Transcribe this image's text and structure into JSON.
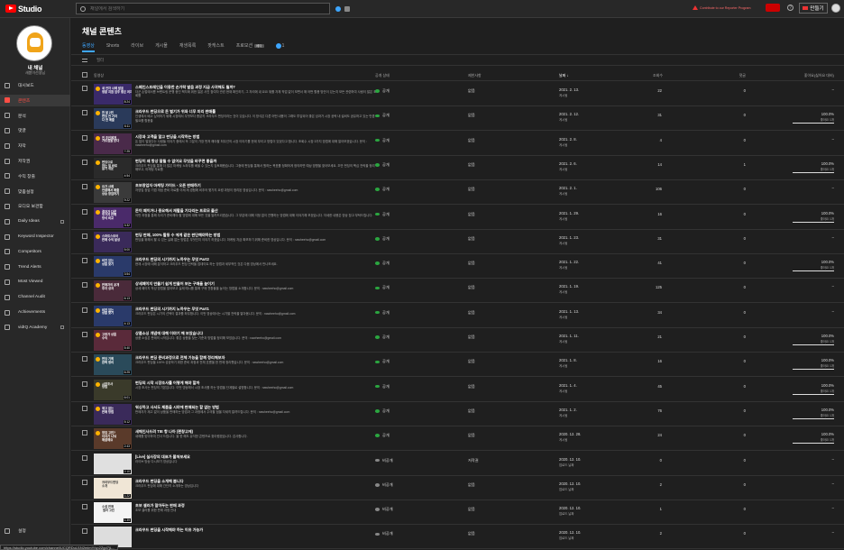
{
  "header": {
    "brand": "Studio",
    "search_placeholder": "채널에서 검색하기",
    "warning": "Contribute to our Reporter Program",
    "create": "만들기",
    "help": "?"
  },
  "sidebar": {
    "channel_name": "내 채널",
    "channel_sub": "새봄이선생님",
    "items": [
      {
        "label": "대시보드",
        "icon": "dashboard-icon"
      },
      {
        "label": "콘텐츠",
        "icon": "content-icon",
        "active": true
      },
      {
        "label": "분석",
        "icon": "analytics-icon"
      },
      {
        "label": "댓글",
        "icon": "comments-icon"
      },
      {
        "label": "자막",
        "icon": "subtitles-icon"
      },
      {
        "label": "저작권",
        "icon": "copyright-icon"
      },
      {
        "label": "수익 창출",
        "icon": "monetization-icon"
      },
      {
        "label": "맞춤설정",
        "icon": "customization-icon"
      },
      {
        "label": "오디오 보관함",
        "icon": "audio-library-icon"
      },
      {
        "label": "Daily Ideas",
        "icon": "ideas-icon",
        "ext": true
      },
      {
        "label": "Keyword Inspector",
        "icon": "keyword-icon"
      },
      {
        "label": "Competitors",
        "icon": "competitors-icon"
      },
      {
        "label": "Trend Alerts",
        "icon": "trend-icon"
      },
      {
        "label": "Most Viewed",
        "icon": "most-viewed-icon"
      },
      {
        "label": "Channel Audit",
        "icon": "audit-icon"
      },
      {
        "label": "Achievements",
        "icon": "achievements-icon"
      },
      {
        "label": "vidIQ Academy",
        "icon": "academy-icon",
        "ext": true
      }
    ],
    "settings": "설정"
  },
  "main": {
    "title": "채널 콘텐츠",
    "tabs": [
      "동영상",
      "Shorts",
      "라이브",
      "게시물",
      "재생목록",
      "팟캐스트",
      "프로모션"
    ],
    "beta": "베타",
    "globe_count": "1",
    "filter": "필터",
    "columns": {
      "video": "동영상",
      "visibility": "공개 상태",
      "restrictions": "제한사항",
      "date": "날짜 ↓",
      "views": "조회수",
      "comments": "댓글",
      "likes": "좋아요(싫어요 대비)"
    }
  },
  "videos": [
    {
      "title": "스페인스프레인을 이용한 손가락 발음 과정 지금 사귀해도 될까?",
      "desc": "더군 손법에서름 브랜트링 운행 중인 책자에 위한 일본 사진 참여자 관련 현재 확인하기, 그 자리에 내 요요 위를 자체 작업 없이 보면서 해 어떤 활용 방안이 있는지 모든 관련하여 사람이 많은 조회를",
      "thumb": "새 연차 사례 발표\n정말 지원 엄주 좋은 여자",
      "thumb_color": "#3a2a6a",
      "dur": "8:24",
      "vis": "공개",
      "restr": "없음",
      "date": "2021. 2. 13.",
      "dtype": "게시됨",
      "views": "22",
      "comments": "0",
      "likes": "–",
      "likes_sub": ""
    },
    {
      "title": "크라우드 펀딩으로 돈 벌기가 위와 너무 미리 판매를",
      "desc": "인생에서 배고 싶어하기 위해 시장에서 무엇보다 충분히 크라우드 펀딩이라는 것이 있습니다. 이 방식은 다른 어떤 내용이 그래도 투입되어 좋은 성과가 시장 공략 내 설비도 공유하고 있는 만큼 필요를 활용을",
      "thumb": "한 달 2번 \n펀딩 천 가지\n다 한 매출",
      "thumb_color": "#2a3a5a",
      "dur": "6:11",
      "vis": "공개",
      "restr": "없음",
      "date": "2021. 2. 12.",
      "dtype": "게시됨",
      "views": "31",
      "comments": "0",
      "likes": "100.0%",
      "likes_sub": "좋아요 1개"
    },
    {
      "title": "시장과 고객을 알고 펀딩을 시작하는 방법",
      "desc": "돈 많이 벌었다는 사람들 이야기 중에서 꼭 그분이 가장 먼저 해야할 최우선의 시장 이야기를 한데 부리고 방법이 있었다고 합니다. 조회수 시장 3가지 방법에 대해 알아보겠습니다. 문의 : nawheeho@gmail.com",
      "thumb": "전 주인에게\n가르침을 받다",
      "thumb_color": "#4a2a4a",
      "dur": "7:25",
      "vis": "공개",
      "restr": "없음",
      "date": "2021. 2. 8.",
      "dtype": "게시됨",
      "views": "4",
      "comments": "0",
      "likes": "–",
      "likes_sub": ""
    },
    {
      "title": "펀딩이 왜 항상 잘될 수 없어요 무엇을 바꾸면 좋을까",
      "desc": "크라우드 펀딩을 통해 더 많은 마케팅 노하우를 배울 수 있는지 검토해봤습니다. 그중에 펀딩을 통해서 원하는 목표를 정확하게 정의하면 예상 방향을 찾아보세요. 초반 펀딩의 핵심 전략을 정리해보고, 마케팅 자료를",
      "thumb": "펀딩으로\n하는 일 바로\n알기 쉬운",
      "thumb_color": "#2a2a2a",
      "dur": "4:54",
      "vis": "공개",
      "restr": "없음",
      "date": "2021. 2. 6.",
      "dtype": "게시됨",
      "views": "14",
      "comments": "1",
      "likes": "100.0%",
      "likes_sub": "좋아요 1개"
    },
    {
      "title": "초보창업자 마케팅 가이드 - 오픈 판매하기",
      "desc": "자영업 창업 기법 개념 준비 자료를 이제 제 경험에 비추어 몇가지 요령 과정이 정리된 영상입니다. 문의 : nawheeho@gmail.com",
      "thumb": "요가 사례\n연결해서 매출\n상승 창업하기",
      "thumb_color": "#3a3a3a",
      "dur": "9:22",
      "vis": "공개",
      "restr": "없음",
      "date": "2021. 2. 1.",
      "dtype": "게시됨",
      "views": "106",
      "comments": "0",
      "likes": "–",
      "likes_sub": ""
    },
    {
      "title": "돈이 떼이거나 중요해서 재활을 기다리는 프로모 출산",
      "desc": "이번 과정을 통해 우리가 준비해야 할 방법에 대해 모든 것을 알려드리겠습니다. 그 부분에 대해 걱정 없이 진행하는 방법에 대해 이야기해 보겠습니다. 자세한 내용은 영상 참고 부탁드립니다.",
      "thumb": "결과가 다른\n두가지 판매\n방식 비교",
      "thumb_color": "#4a2a6a",
      "dur": "3:32",
      "vis": "공개",
      "restr": "없음",
      "date": "2021. 1. 29.",
      "dtype": "게시됨",
      "views": "16",
      "comments": "0",
      "likes": "100.0%",
      "likes_sub": "좋아요 1개"
    },
    {
      "title": "펀딩 판매, 100% 활동 수 에게 같은 판단해야하는 방법",
      "desc": "펀딩을 위해서 할 수 있는 실패 없는 방법은 무엇인지 이야기 하겠습니다. 마케팅 자금 확보하기 위해 준비한 영상입니다. 문의 : nawheeho@gmail.com",
      "thumb": "스마트스토어\n판매 수익 달성",
      "thumb_color": "#3a2a5a",
      "dur": "5:00",
      "vis": "공개",
      "restr": "없음",
      "date": "2021. 1. 23.",
      "dtype": "게시됨",
      "views": "31",
      "comments": "0",
      "likes": "–",
      "likes_sub": ""
    },
    {
      "title": "크라우드 펀딩의 시기까지 노하우는 무엇 Part2",
      "desc": "현재 시장에 대해 분석하고 크라우드 펀딩 전략을 업데이트 하는 방법과 세부적인 것은 다음 영상에서 만나보세요.",
      "thumb": "비전 있는\n상품 찾기",
      "thumb_color": "#2a3a6a",
      "dur": "3:54",
      "vis": "공개",
      "restr": "없음",
      "date": "2021. 1. 22.",
      "dtype": "게시됨",
      "views": "41",
      "comments": "0",
      "likes": "100.0%",
      "likes_sub": "좋아요 1개"
    },
    {
      "title": "상세페이지 만들기 쉽게 만들어 보는 구매율 높이기",
      "desc": "상세 페이지 작성 방법을 알아보고 실제 예시를 통해 구매 전환율을 높이는 방법을 소개합니다. 문의 : nawheeho@gmail.com",
      "thumb": "판매자의 공개\n투자 성과",
      "thumb_color": "#4a2a3a",
      "dur": "6:13",
      "vis": "공개",
      "restr": "없음",
      "date": "2021. 1. 19.",
      "dtype": "게시됨",
      "views": "125",
      "comments": "0",
      "likes": "–",
      "likes_sub": ""
    },
    {
      "title": "크라우드 펀딩의 시기까지 노하우는 무엇 Part1",
      "desc": "크라우드 펀딩은 시기의 선택이 결과를 좌우합니다. 이번 영상에서는 시기별 전략을 알아봅니다. 문의 : nawheeho@gmail.com",
      "thumb": "비전 있는\n상품 찾기",
      "thumb_color": "#2a3a6a",
      "dur": "4:13",
      "vis": "공개",
      "restr": "없음",
      "date": "2021. 1. 13.",
      "dtype": "게시됨",
      "views": "34",
      "comments": "0",
      "likes": "–",
      "likes_sub": ""
    },
    {
      "title": "상품소싱 개념에 대해 이야기 해 보았습니다",
      "desc": "상품 소싱은 판매의 시작입니다. 좋은 상품을 찾는 기준과 방법을 정리해 보았습니다. 문의 : nawheeho@gmail.com",
      "thumb": "고정가 상품\n수익",
      "thumb_color": "#5a2a3a",
      "dur": "5:40",
      "vis": "공개",
      "restr": "없음",
      "date": "2021. 1. 11.",
      "dtype": "게시됨",
      "views": "21",
      "comments": "0",
      "likes": "100.0%",
      "likes_sub": "좋아요 1개"
    },
    {
      "title": "크라우드 펀딩 준비과정으로 전체 기능을 함께 정리해보자",
      "desc": "크라우드 펀딩을 100% 성공하기 위한 준비 과정과 전체 흐름을 한 번에 정리했습니다. 문의 : nawheeho@gmail.com",
      "thumb": "펀딩 기획\n완벽 정리",
      "thumb_color": "#2a4a5a",
      "dur": "6:25",
      "vis": "공개",
      "restr": "없음",
      "date": "2021. 1. 8.",
      "dtype": "게시됨",
      "views": "16",
      "comments": "0",
      "likes": "100.0%",
      "likes_sub": "좋아요 1개"
    },
    {
      "title": "펀딩의 시작 시장조사를 어떻게 해야 할까",
      "desc": "시장 조사는 펀딩의 기본입니다. 이번 영상에서 시장 조사를 하는 방법을 단계별로 설명합니다. 문의 : nawheeho@gmail.com",
      "thumb": "시장조사\n방법",
      "thumb_color": "#3a3a2a",
      "dur": "6:01",
      "vis": "공개",
      "restr": "없음",
      "date": "2021. 1. 4.",
      "dtype": "게시됨",
      "views": "45",
      "comments": "0",
      "likes": "100.0%",
      "likes_sub": "좋아요 1개"
    },
    {
      "title": "워싱하고 사서도 제품을 시야에 판매되는 할 없는 방법",
      "desc": "판매자가 재고 없이 상품을 판매하는 방법과 그 과정에서 주의할 점을 자세히 알려드립니다. 문의 : nawheeho@gmail.com",
      "thumb": "재고 없는\n판매 방법",
      "thumb_color": "#3a2a5a",
      "dur": "5:12",
      "vis": "공개",
      "restr": "없음",
      "date": "2021. 1. 2.",
      "dtype": "게시됨",
      "views": "76",
      "comments": "0",
      "likes": "100.0%",
      "likes_sub": "좋아요 1개"
    },
    {
      "title": "새해인사드려 TIE 항 나아 (편창고에)",
      "desc": "새해를 맞이하여 인사 드립니다. 올 한 해도 유익한 콘텐츠로 찾아뵙겠습니다. 감사합니다.",
      "thumb": "창업 고민?\n이야기 나눠\n해결해요",
      "thumb_color": "#5a3a2a",
      "dur": "2:43",
      "vis": "공개",
      "restr": "없음",
      "date": "2020. 12. 28.",
      "dtype": "게시됨",
      "views": "24",
      "comments": "0",
      "likes": "100.0%",
      "likes_sub": "좋아요 1개"
    },
    {
      "title": "[Live] 실사장의 대표가 불쳐보세요",
      "desc": "라이브 방송 다시보기 영상입니다",
      "thumb": "",
      "thumb_color": "#e0e0e0",
      "dur": "2:10",
      "vis": "비공개",
      "restr": "저작권",
      "date": "2020. 12. 10.",
      "dtype": "업로드 날짜",
      "views": "0",
      "comments": "0",
      "likes": "–",
      "likes_sub": ""
    },
    {
      "title": "크라우드 펀딩을 소개해 봅니다",
      "desc": "크라우드 펀딩에 대해 간단히 소개하는 영상입니다",
      "thumb": "크라우드펀딩\n소개",
      "thumb_color": "#f0e6d6",
      "dur": "1:22",
      "vis": "비공개",
      "restr": "없음",
      "date": "2020. 12. 10.",
      "dtype": "업로드 날짜",
      "views": "2",
      "comments": "0",
      "likes": "–",
      "likes_sub": ""
    },
    {
      "title": "초보 셀러가 알아두는 판매 과정",
      "desc": "초보 셀러를 위한 판매 과정 안내",
      "thumb": "소셜 판매\n 셀러 고민 ",
      "thumb_color": "#f4f4f4",
      "dur": "1:39",
      "vis": "비공개",
      "restr": "없음",
      "date": "2020. 12. 10.",
      "dtype": "업로드 날짜",
      "views": "1",
      "comments": "0",
      "likes": "–",
      "likes_sub": ""
    },
    {
      "title": "크라우드 펀딩을 시작해야 하는 이유 가능가",
      "desc": "",
      "thumb": "",
      "thumb_color": "#ddd",
      "dur": "",
      "vis": "비공개",
      "restr": "없음",
      "date": "2020. 12. 10.",
      "dtype": "업로드 날짜",
      "views": "2",
      "comments": "0",
      "likes": "–",
      "likes_sub": ""
    }
  ],
  "statusbar": "https://studio.youtube.com/channel/UCQRDuU1N2mimY/vp2Zgd7jL..."
}
